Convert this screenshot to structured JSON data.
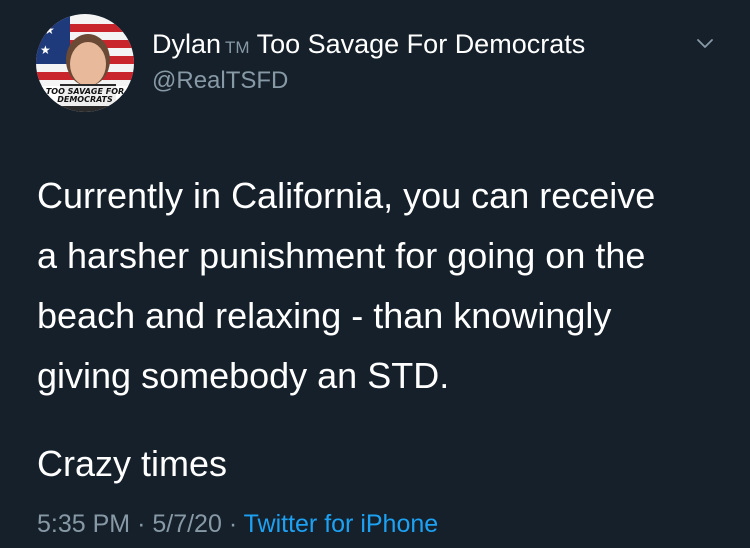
{
  "author": {
    "name": "Dylan",
    "tm": "TM",
    "name_suffix": "Too Savage For Democrats",
    "handle": "@RealTSFD",
    "avatar_caption_line1": "TOO SAVAGE FOR",
    "avatar_caption_line2": "DEMOCRATS"
  },
  "tweet": {
    "lines": [
      "Currently in California, you can receive",
      "a harsher punishment for going on the",
      "beach and relaxing - than knowingly",
      "giving somebody an STD."
    ],
    "second_paragraph": "Crazy times"
  },
  "meta": {
    "time": "5:35 PM",
    "separator": "·",
    "date": "5/7/20",
    "source": "Twitter for iPhone"
  },
  "icons": {
    "more": "chevron-down-icon"
  },
  "colors": {
    "background": "#15202b",
    "text": "#ffffff",
    "secondary": "#8899a6",
    "link": "#1da1f2"
  }
}
